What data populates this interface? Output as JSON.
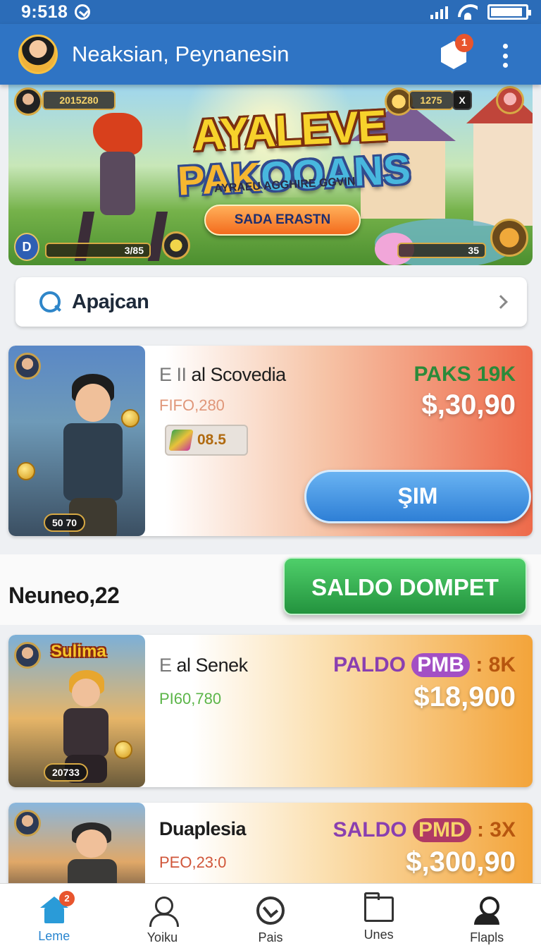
{
  "status_bar": {
    "time": "9:518"
  },
  "app_bar": {
    "title": "Neaksian, Peynanesin",
    "notification_count": "1"
  },
  "banner": {
    "title_line1": "AYALEVE",
    "title_line2a": "PAK",
    "title_line2b": "OOANS",
    "tagline": "AYRAEU AGGHIRE GGVIN",
    "cta_label": "SADA ERASTN",
    "hud_score": "2015Z80",
    "hud_gold": "1275",
    "hud_close": "X",
    "hud_level": "D",
    "hud_bar_left": "3/85",
    "hud_bar_right": "35"
  },
  "search": {
    "value": "Apajcan"
  },
  "offers": [
    {
      "name_prefix": "E II",
      "name": "al Scovedia",
      "sub": "FIFO,280",
      "sub_color": "#e0977a",
      "tag": "PAKS 19K",
      "price": "$,30,90",
      "rating": "08.5",
      "art_chip": "50 70",
      "button_label": "ŞIM"
    },
    {
      "name_prefix": "E",
      "name": "al Senek",
      "sub": "PI60,780",
      "sub_color": "#5bb548",
      "tag_a": "PALDO",
      "tag_pill": "PMB",
      "tag_b": ": 8K",
      "price": "$18,900",
      "art_title": "Sulima",
      "art_chip": "20733"
    },
    {
      "name_prefix": "",
      "name": "Duaplesia",
      "sub": "PEO,23:0",
      "sub_color": "#d0563a",
      "tag_a": "SALDO",
      "tag_pill": "PMD",
      "tag_b": ": 3X",
      "price": "$,300,90"
    }
  ],
  "section": {
    "label": "Neuneo,22",
    "button_label": "SALDO DOMPET"
  },
  "bottom_nav": {
    "items": [
      {
        "label": "Leme",
        "icon": "home-icon",
        "badge": "2"
      },
      {
        "label": "Yoiku",
        "icon": "user-icon"
      },
      {
        "label": "Pais",
        "icon": "clock-icon"
      },
      {
        "label": "Unes",
        "icon": "folder-icon"
      },
      {
        "label": "Flapls",
        "icon": "person-icon"
      }
    ]
  },
  "colors": {
    "app_bar": "#2f74c4",
    "accent_blue": "#2e7fd6",
    "accent_green": "#23933e",
    "card1_end": "#ee6a4a",
    "card2_end": "#f3a43a"
  }
}
